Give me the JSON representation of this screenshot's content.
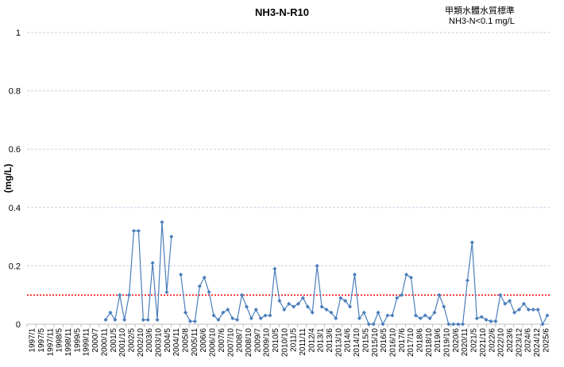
{
  "chart_data": {
    "type": "line",
    "title": "NH3-N-R10",
    "standard_title": "甲類水體水質標準",
    "standard_text": "NH3-N<0.1 mg/L",
    "ylabel": "(mg/L)",
    "xlabel": "",
    "ylim": [
      0,
      1
    ],
    "yticks": [
      "0",
      "0.2",
      "0.4",
      "0.6",
      "0.8",
      "1"
    ],
    "grid": true,
    "threshold": 0.1,
    "colors": {
      "series": "#4a7ebb",
      "threshold": "#ff0000",
      "grid": "#c8d0e6"
    },
    "categories": [
      "1997/1",
      "1997/5",
      "1997/11",
      "1998/5",
      "1998/11",
      "1999/5",
      "1999/11",
      "2000/7",
      "2000/11",
      "2001/5",
      "2001/10",
      "2002/5",
      "2002/10",
      "2003/6",
      "2003/10",
      "2004/5",
      "2004/11",
      "2005/8",
      "2005/11",
      "2006/6",
      "2006/10",
      "2007/6",
      "2007/10",
      "2008/7",
      "2008/10",
      "2009/7",
      "2009/10",
      "2010/5",
      "2010/10",
      "2011/5",
      "2011/11",
      "2012/4",
      "2013/1",
      "2013/6",
      "2013/10",
      "2014/6",
      "2014/10",
      "2015/5",
      "2015/10",
      "2016/5",
      "2016/10",
      "2017/6",
      "2017/10",
      "2018/6",
      "2018/10",
      "2019/6",
      "2019/10",
      "2020/6",
      "2020/11",
      "2021/5",
      "2021/10",
      "2022/6",
      "2022/10",
      "2023/6",
      "2023/12",
      "2024/6",
      "2024/12",
      "2025/6"
    ],
    "series": [
      {
        "values": [
          0.015,
          0.04,
          0.015,
          0.1,
          0.015,
          0.1,
          0.32,
          0.32,
          0.015,
          0.015,
          0.21,
          0.015,
          0.35,
          0.11,
          0.3,
          null,
          0.17,
          0.04,
          0.01,
          0.01,
          0.13,
          0.16,
          0.11,
          0.03,
          0.015,
          0.04,
          0.05,
          0.02,
          0.015,
          0.1,
          0.06,
          0.02,
          0.05,
          0.02,
          0.03,
          0.03,
          0.19,
          0.08,
          0.05,
          0.07,
          0.06,
          0.07,
          0.09,
          0.06,
          0.04,
          0.2,
          0.06,
          0.05,
          0.04,
          0.02,
          0.09,
          0.08,
          0.06,
          0.17,
          0.02,
          0.04,
          0,
          0,
          0.04,
          0,
          0.03,
          0.03,
          0.09,
          0.1,
          0.17,
          0.16,
          0.03,
          0.02,
          0.03,
          0.02,
          0.04,
          0.1,
          0.06,
          0,
          0,
          0,
          0,
          0.15,
          0.28,
          0.02,
          0.025,
          0.015,
          0.01,
          0.01,
          0.1,
          0.07,
          0.08,
          0.04,
          0.05,
          0.07,
          0.05,
          0.05,
          0.05,
          0,
          0.03
        ]
      }
    ]
  }
}
